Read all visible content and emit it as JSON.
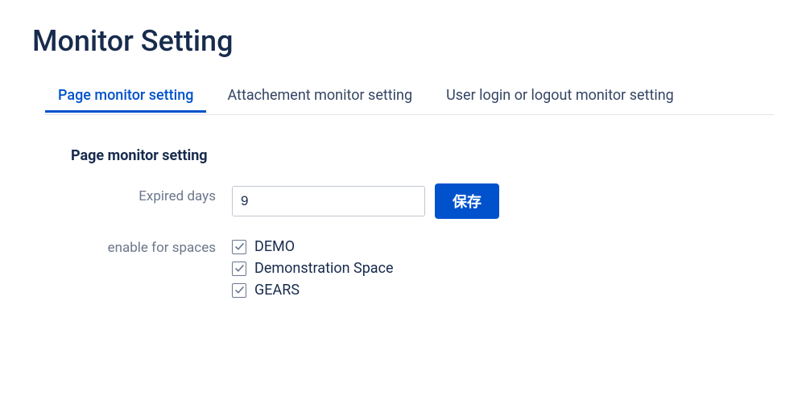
{
  "title": "Monitor Setting",
  "tabs": [
    {
      "label": "Page monitor setting",
      "active": true
    },
    {
      "label": "Attachement monitor setting",
      "active": false
    },
    {
      "label": "User login or logout monitor setting",
      "active": false
    }
  ],
  "section": {
    "heading": "Page monitor setting",
    "expired_label": "Expired days",
    "expired_value": "9",
    "save_label": "保存",
    "spaces_label": "enable for spaces",
    "spaces": [
      {
        "name": "DEMO",
        "checked": true
      },
      {
        "name": "Demonstration Space",
        "checked": true
      },
      {
        "name": "GEARS",
        "checked": true
      }
    ]
  }
}
